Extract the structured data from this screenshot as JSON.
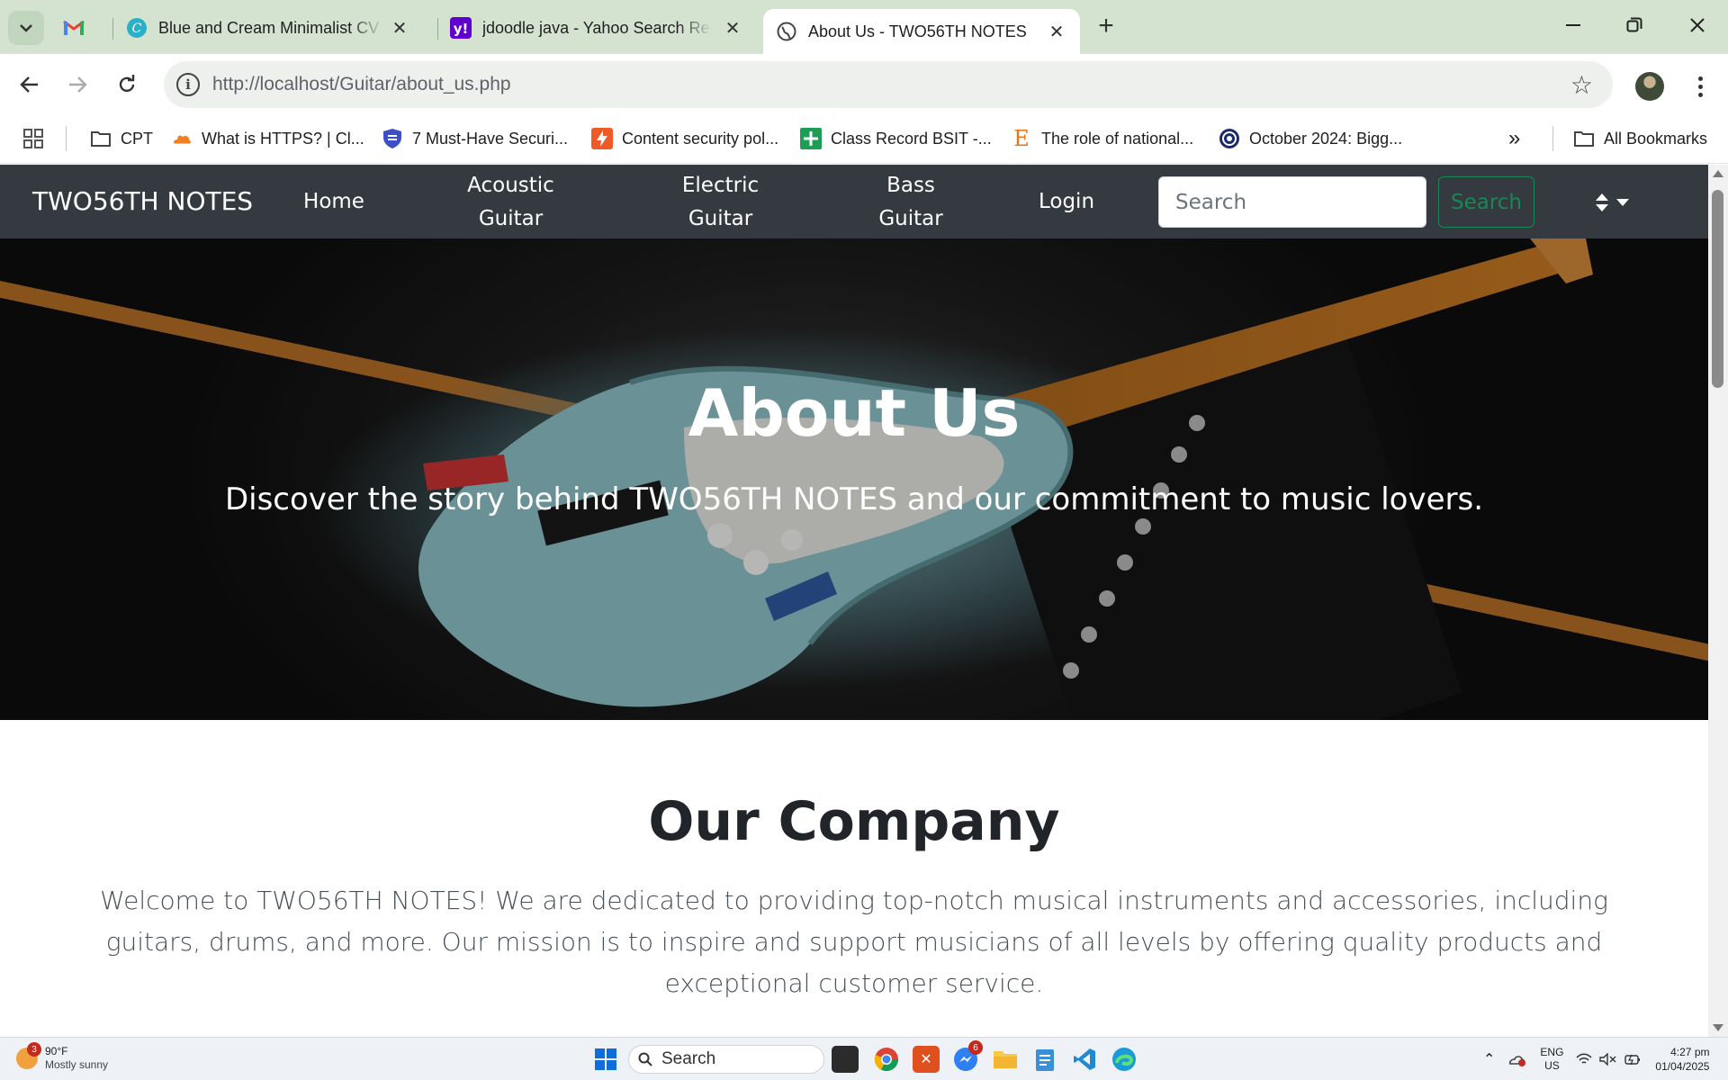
{
  "browser": {
    "tabs": [
      {
        "title": "",
        "icon": "gmail-icon"
      },
      {
        "title": "Blue and Cream Minimalist CV R",
        "icon": "canva-icon"
      },
      {
        "title": "jdoodle java - Yahoo Search Res",
        "icon": "yahoo-icon"
      },
      {
        "title": "About Us - TWO56TH NOTES",
        "icon": "globe-icon",
        "active": true
      }
    ],
    "url_host": "http://localhost",
    "url_path": "/Guitar/about_us.php",
    "bookmarks": [
      {
        "label": "CPT",
        "icon": "folder-icon"
      },
      {
        "label": "What is HTTPS? | Cl...",
        "icon": "cloudflare-icon"
      },
      {
        "label": "7 Must-Have Securi...",
        "icon": "shield-icon"
      },
      {
        "label": "Content security pol...",
        "icon": "bolt-icon"
      },
      {
        "label": "Class Record BSIT -...",
        "icon": "sheets-icon"
      },
      {
        "label": "The role of national...",
        "icon": "e-icon"
      },
      {
        "label": "October 2024: Bigg...",
        "icon": "target-icon"
      }
    ],
    "all_bookmarks": "All Bookmarks"
  },
  "navbar": {
    "brand": "TWO56TH NOTES",
    "links": [
      "Home",
      "Acoustic Guitar",
      "Electric Guitar",
      "Bass Guitar",
      "Login"
    ],
    "search_placeholder": "Search",
    "search_button": "Search"
  },
  "hero": {
    "title": "About Us",
    "subtitle": "Discover the story behind TWO56TH NOTES and our commitment to music lovers."
  },
  "company": {
    "title": "Our Company",
    "body": "Welcome to TWO56TH NOTES! We are dedicated to providing top-notch musical instruments and accessories, including guitars, drums, and more. Our mission is to inspire and support musicians of all levels by offering quality products and exceptional customer service."
  },
  "taskbar": {
    "weather_temp": "90°F",
    "weather_desc": "Mostly sunny",
    "weather_badge": "3",
    "search_label": "Search",
    "messenger_badge": "6",
    "lang_top": "ENG",
    "lang_bottom": "US",
    "time": "4:27 pm",
    "date": "01/04/2025"
  },
  "colors": {
    "navbar_bg": "#343a40",
    "search_button": "#198754",
    "tabstrip_bg": "#d3e3d0"
  }
}
